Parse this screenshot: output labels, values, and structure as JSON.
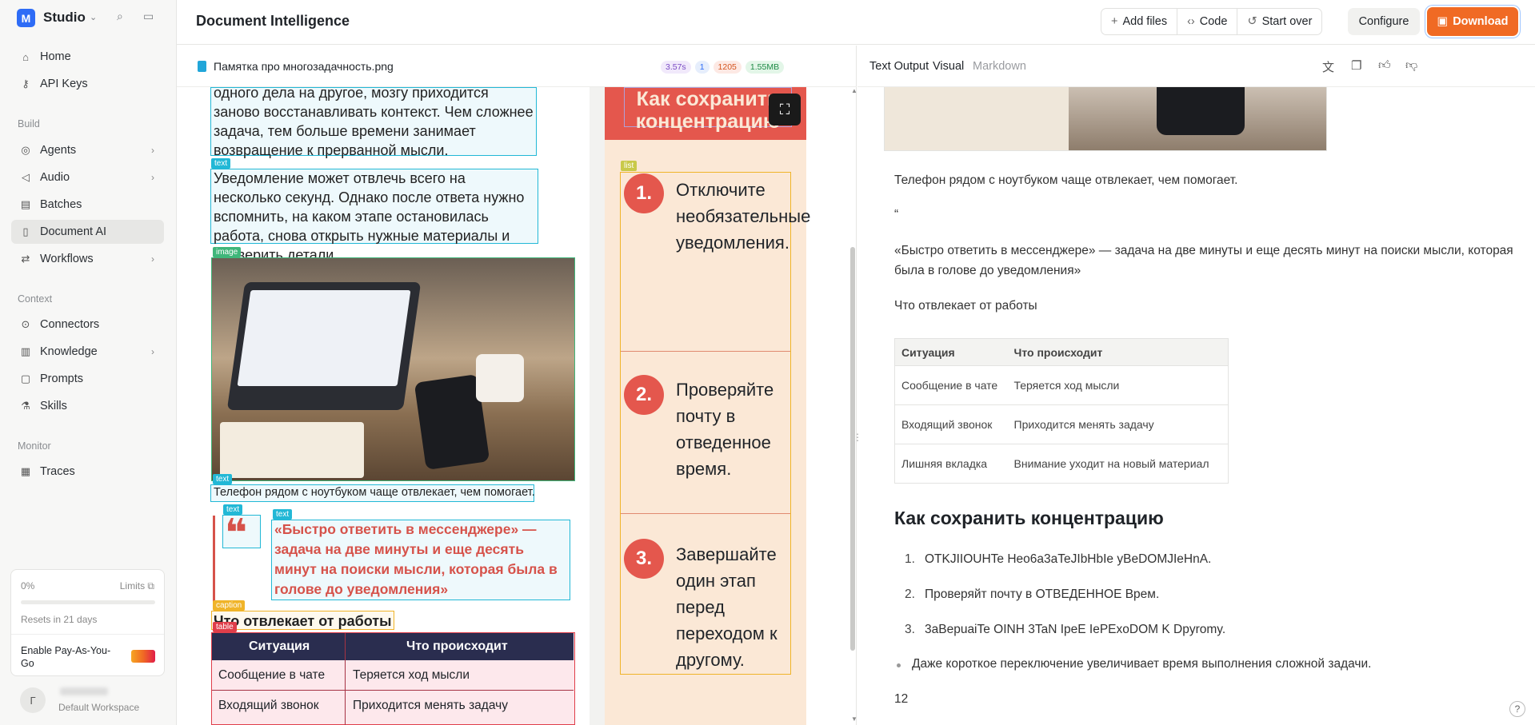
{
  "sidebar": {
    "app_name": "Studio",
    "nav": [
      {
        "label": "Home",
        "icon": "home-icon"
      },
      {
        "label": "API Keys",
        "icon": "key-icon"
      }
    ],
    "build_label": "Build",
    "build": [
      {
        "label": "Agents",
        "icon": "agents-icon"
      },
      {
        "label": "Audio",
        "icon": "audio-icon"
      },
      {
        "label": "Batches",
        "icon": "batches-icon"
      },
      {
        "label": "Document AI",
        "icon": "document-icon"
      },
      {
        "label": "Workflows",
        "icon": "workflows-icon"
      }
    ],
    "context_label": "Context",
    "context": [
      {
        "label": "Connectors",
        "icon": "connectors-icon"
      },
      {
        "label": "Knowledge",
        "icon": "knowledge-icon"
      },
      {
        "label": "Prompts",
        "icon": "prompts-icon"
      },
      {
        "label": "Skills",
        "icon": "skills-icon"
      }
    ],
    "monitor_label": "Monitor",
    "monitor": [
      {
        "label": "Traces",
        "icon": "traces-icon"
      }
    ],
    "usage": {
      "percent": "0%",
      "limits_label": "Limits",
      "reset_text": "Resets in 21 days",
      "progress": 0,
      "payg_label": "Enable Pay-As-You-Go"
    },
    "workspace": {
      "avatar": "Г",
      "name": "Default Workspace"
    }
  },
  "header": {
    "title": "Document Intelligence",
    "add_files": "Add files",
    "code": "Code",
    "start_over": "Start over",
    "configure": "Configure",
    "download": "Download"
  },
  "file": {
    "name": "Памятка про многозадачность.png",
    "chips": [
      "3.57s",
      "1",
      "1205",
      "1.55MB"
    ]
  },
  "document": {
    "para1": "одного дела на другое, мозгу приходится заново восстанавливать контекст. Чем сложнее задача, тем больше времени занимает возвращение к прерванной мысли.",
    "para2": "Уведомление может отвлечь всего на несколько секунд. Однако после ответа нужно вспомнить, на каком этапе остановилась работа, снова открыть нужные материалы и проверить детали.",
    "caption_image": "Телефон рядом с ноутбуком чаще отвлекает, чем помогает.",
    "quote": "«Быстро ответить в мессенджере» — задача на две минуты и еще десять минут на поиски мысли, которая была в голове до уведомления»",
    "caption_table": "Что отвлекает от работы",
    "table_head": [
      "Ситуация",
      "Что происходит"
    ],
    "table_rows": [
      [
        "Сообщение в чате",
        "Теряется ход мысли"
      ],
      [
        "Входящий звонок",
        "Приходится менять задачу"
      ]
    ],
    "banner": "Как сохранить концентрацию",
    "steps": [
      {
        "n": "1.",
        "text": "Отключите необязательные уведомления."
      },
      {
        "n": "2.",
        "text": "Проверяйте почту в отведенное время."
      },
      {
        "n": "3.",
        "text": "Завершайте один этап перед переходом к другому."
      }
    ],
    "tags": {
      "text": "text",
      "image": "image",
      "caption": "caption",
      "table": "table",
      "list": "list"
    }
  },
  "output": {
    "tabs": [
      "Text Output",
      "Visual",
      "Markdown"
    ],
    "caption": "Телефон рядом с ноутбуком чаще отвлекает, чем помогает.",
    "quote_mark": "“",
    "quote": "«Быстро ответить в мессенджере» — задача на две минуты и еще десять минут на поиски мысли, которая была в голове до уведомления»",
    "table_caption": "Что отвлекает от работы",
    "table_head": [
      "Ситуация",
      "Что происходит"
    ],
    "table_rows": [
      [
        "Сообщение в чате",
        "Теряется ход мысли"
      ],
      [
        "Входящий звонок",
        "Приходится менять задачу"
      ],
      [
        "Лишняя вкладка",
        "Внимание уходит на новый материал"
      ]
    ],
    "heading": "Как сохранить концентрацию",
    "steps": [
      "OTKJIIOUHTe Heo6a3aTeJIbHbIe yBeDOMJIeHnA.",
      "Проверяйт почту в ОТВЕДЕННОЕ Врем.",
      "3aBepuaiTe OINH 3TaN IpeE IePExoDOM K Dpyromy."
    ],
    "step_numbers": [
      "1.",
      "2.",
      "3."
    ],
    "bullet": "Даже короткое переключение увеличивает время выполнения сложной задачи.",
    "page_number": "12"
  },
  "colors": {
    "accent": "#f06a24",
    "brand": "#2e6cf6",
    "box": "#22b8d6"
  }
}
